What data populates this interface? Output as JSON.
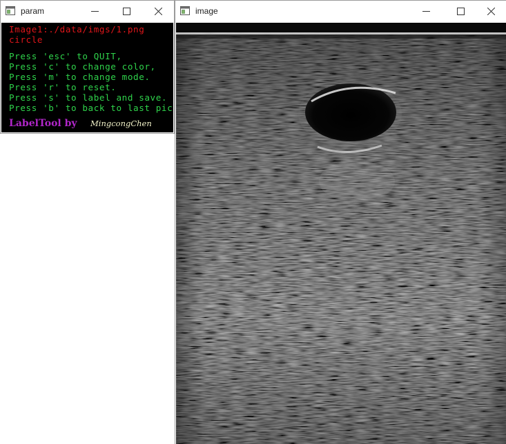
{
  "param_window": {
    "title": "param",
    "lines": {
      "image_path": "Image1:./data/imgs/1.png",
      "mode": "circle",
      "help": [
        "Press 'esc' to QUIT,",
        "Press 'c' to change color,",
        "Press 'm' to change mode.",
        "Press 'r' to reset.",
        "Press 's' to label and save.",
        "Press 'b' to back to last pic"
      ],
      "brand": "LabelTool by",
      "author": "MingcongChen"
    }
  },
  "image_window": {
    "title": "image"
  },
  "colors": {
    "path_text": "#e0161a",
    "help_text": "#2fd34b",
    "brand_text": "#b026c9",
    "author_text": "#f2f2c8",
    "param_background": "#000000"
  },
  "icons": [
    "app-window-icon",
    "minimize-icon",
    "maximize-icon",
    "close-icon"
  ]
}
